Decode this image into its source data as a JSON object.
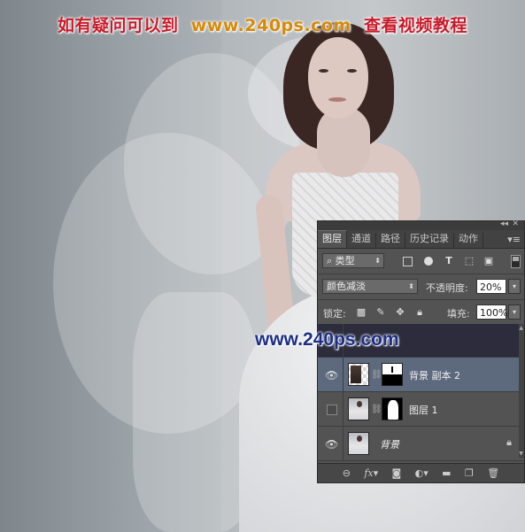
{
  "banner": {
    "part1": "如有疑问可以到",
    "part2": "www.240ps.com",
    "part3": "查看视频教程"
  },
  "watermark": "www.240ps.com",
  "panel": {
    "tabs": [
      "图层",
      "通道",
      "路径",
      "历史记录",
      "动作"
    ],
    "active_tab": "图层",
    "filter": {
      "label": "类型"
    },
    "blend_mode": "颜色减淡",
    "opacity_label": "不透明度:",
    "opacity_value": "20%",
    "lock_label": "锁定:",
    "fill_label": "填充:",
    "fill_value": "100%",
    "layers": [
      {
        "name": "背景 副本 2",
        "visible": true,
        "selected": true
      },
      {
        "name": "图层 1",
        "visible": false,
        "selected": false
      },
      {
        "name": "背景",
        "visible": true,
        "selected": false,
        "locked": true
      }
    ],
    "bottom_icons": [
      "link-icon",
      "fx-icon",
      "mask-icon",
      "adjustment-icon",
      "folder-icon",
      "new-layer-icon",
      "trash-icon"
    ],
    "fx_label": "fx"
  }
}
